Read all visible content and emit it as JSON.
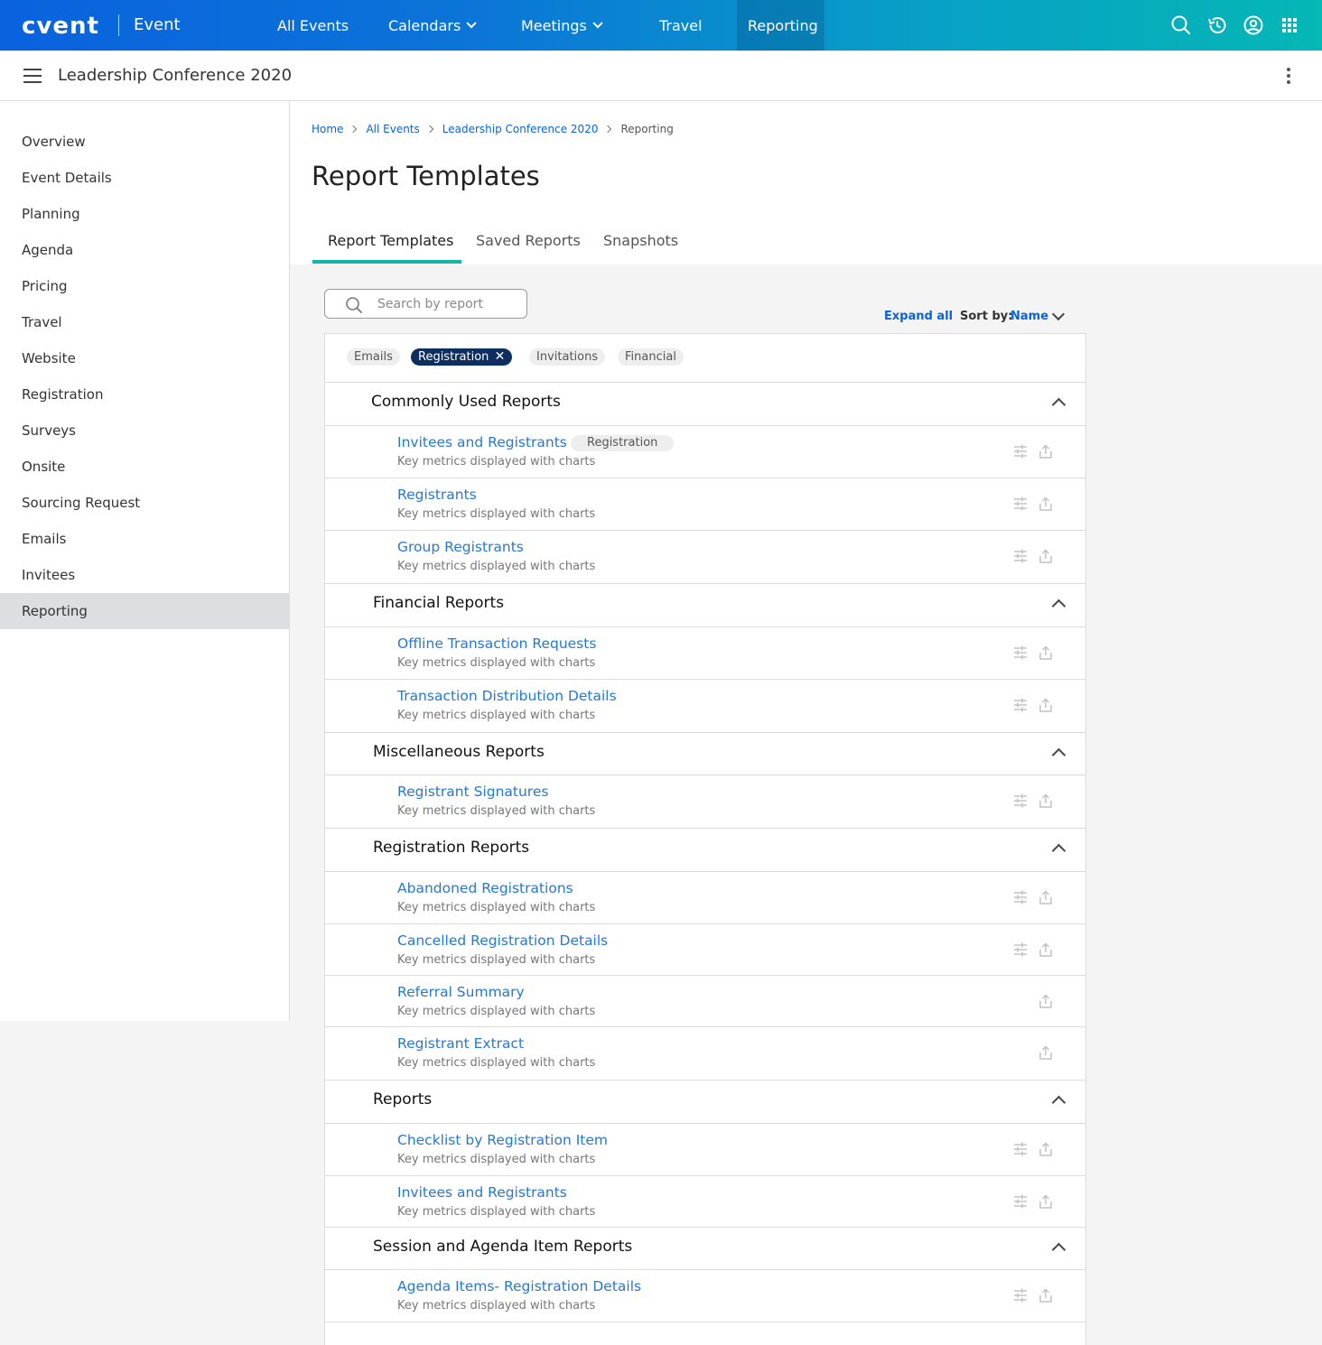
{
  "topbar": {
    "logo": "cvent",
    "product": "Event",
    "nav": [
      "All Events",
      "Calendars",
      "Meetings",
      "Travel",
      "Reporting"
    ]
  },
  "event": {
    "title": "Leadership Conference 2020"
  },
  "sidebar": {
    "items": [
      "Overview",
      "Event Details",
      "Planning",
      "Agenda",
      "Pricing",
      "Travel",
      "Website",
      "Registration",
      "Surveys",
      "Onsite",
      "Sourcing Request",
      "Emails",
      "Invitees",
      "Reporting"
    ],
    "active": "Reporting"
  },
  "breadcrumb": [
    "Home",
    "All Events",
    "Leadership Conference 2020",
    "Reporting"
  ],
  "page": {
    "title": "Report Templates"
  },
  "tabs": [
    "Report Templates",
    "Saved Reports",
    "Snapshots"
  ],
  "search": {
    "placeholder": "Search by report"
  },
  "toolbar": {
    "expand_all": "Expand all",
    "sort_label": "Sort by:",
    "sort_value": "Name"
  },
  "filters": {
    "chips": [
      "Emails",
      "Registration",
      "Invitations",
      "Financial"
    ],
    "selected": "Registration"
  },
  "report_desc": "Key metrics displayed with charts",
  "sections": [
    {
      "title": "Commonly Used Reports",
      "reports": [
        {
          "name": "Invitees and Registrants",
          "tag": "Registration"
        },
        {
          "name": "Registrants"
        },
        {
          "name": "Group Registrants"
        }
      ]
    },
    {
      "title": "Financial Reports",
      "reports": [
        {
          "name": "Offline Transaction Requests"
        },
        {
          "name": "Transaction Distribution Details"
        }
      ]
    },
    {
      "title": "Miscellaneous Reports",
      "reports": [
        {
          "name": "Registrant Signatures"
        }
      ]
    },
    {
      "title": "Registration Reports",
      "reports": [
        {
          "name": "Abandoned Registrations"
        },
        {
          "name": "Cancelled Registration Details"
        },
        {
          "name": "Referral Summary"
        },
        {
          "name": "Registrant Extract"
        }
      ]
    },
    {
      "title": "Reports",
      "reports": [
        {
          "name": "Checklist by Registration Item"
        },
        {
          "name": "Invitees and Registrants"
        }
      ]
    },
    {
      "title": "Session and Agenda Item Reports",
      "reports": [
        {
          "name": "Agenda Items- Registration Details"
        }
      ]
    }
  ]
}
